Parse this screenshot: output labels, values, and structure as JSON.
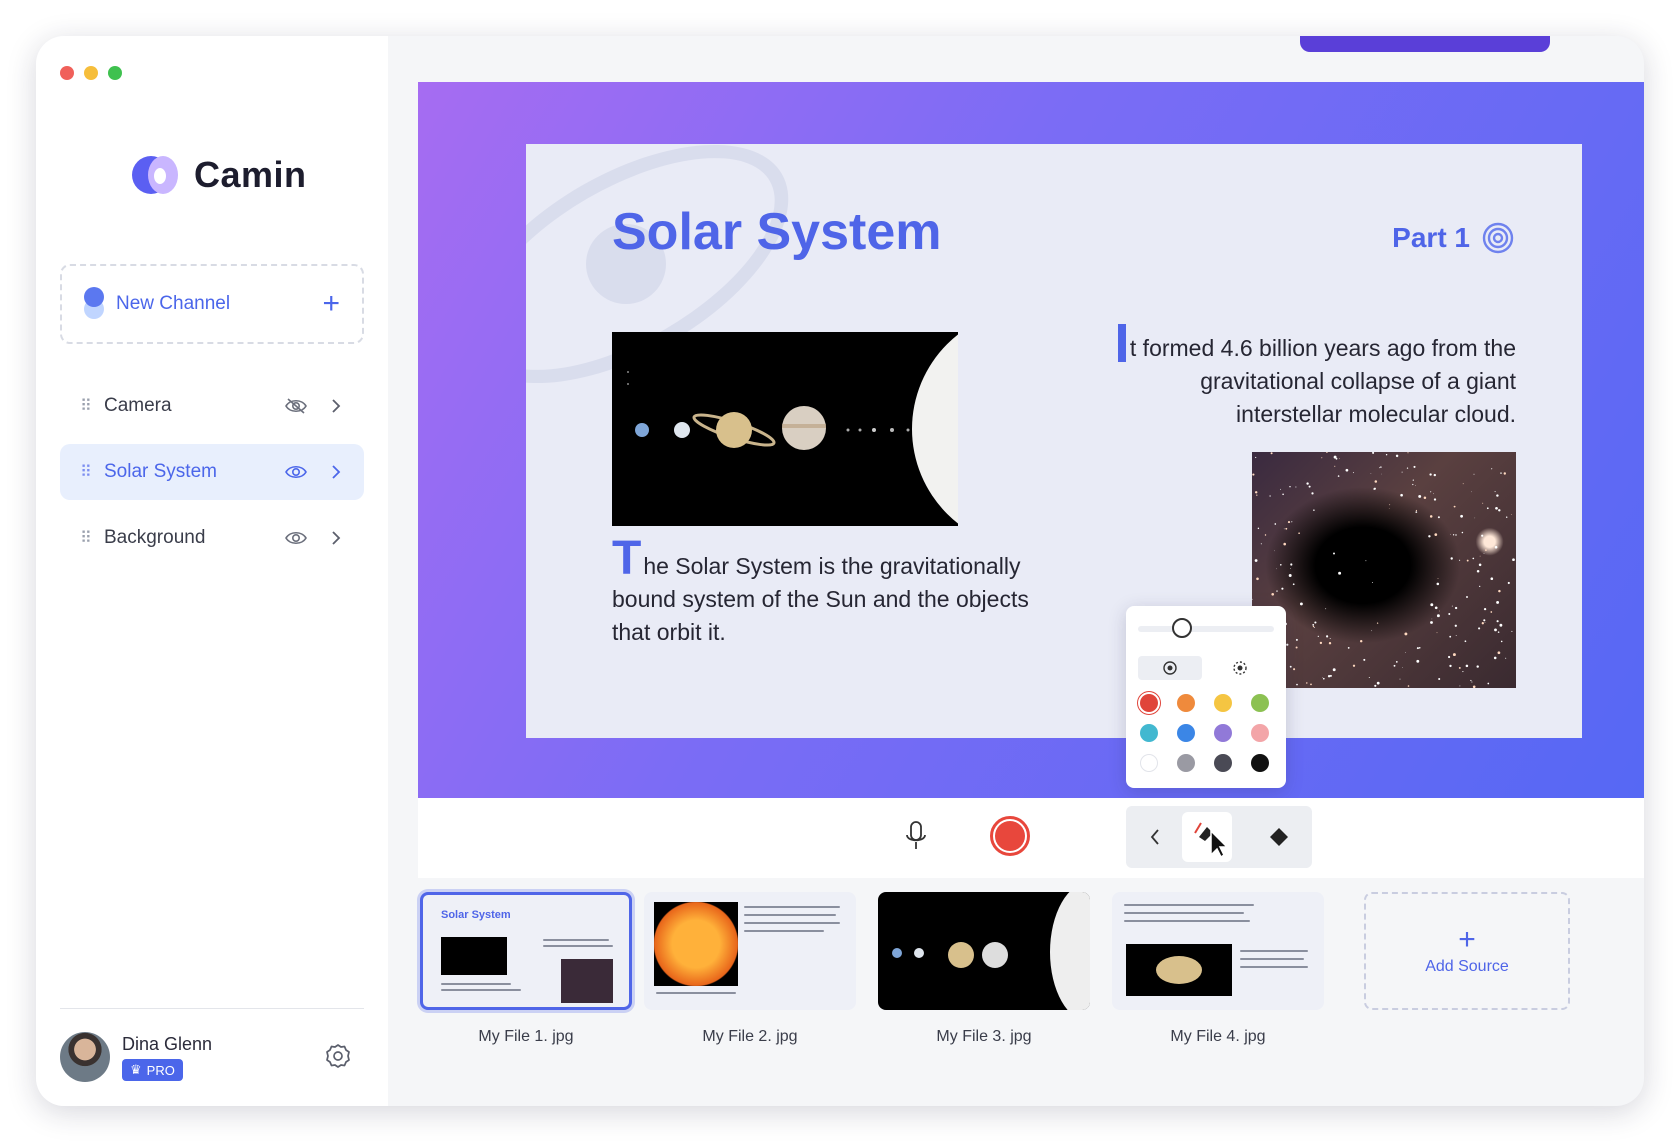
{
  "app": {
    "name": "Camin"
  },
  "sidebar": {
    "new_channel": {
      "label": "New Channel"
    },
    "layers": [
      {
        "label": "Camera",
        "visible": false
      },
      {
        "label": "Solar System",
        "visible": true,
        "active": true
      },
      {
        "label": "Background",
        "visible": true
      }
    ],
    "user": {
      "name": "Dina Glenn",
      "badge": "PRO"
    }
  },
  "slide": {
    "title": "Solar System",
    "part": "Part 1",
    "left_dropcap": "T",
    "left_text": "he Solar System is the gravitationally bound system of the Sun and the objects that orbit it.",
    "right_text": "t formed 4.6 billion years ago from the gravitational collapse of a giant interstellar molecular cloud."
  },
  "pen_panel": {
    "colors": [
      "#e0443a",
      "#ef8a3c",
      "#f5c542",
      "#8cc152",
      "#42b8d0",
      "#3b86e6",
      "#9179d8",
      "#f3a5a8",
      "#ffffff",
      "#9a9aa3",
      "#4a4a55",
      "#111111"
    ],
    "selected_color": "#e0443a"
  },
  "thumbnails": [
    {
      "caption": "My File 1. jpg",
      "active": true,
      "mini_title": "Solar System"
    },
    {
      "caption": "My File 2. jpg",
      "active": false
    },
    {
      "caption": "My File 3. jpg",
      "active": false
    },
    {
      "caption": "My File 4. jpg",
      "active": false
    }
  ],
  "add_source": {
    "label": "Add Source"
  }
}
